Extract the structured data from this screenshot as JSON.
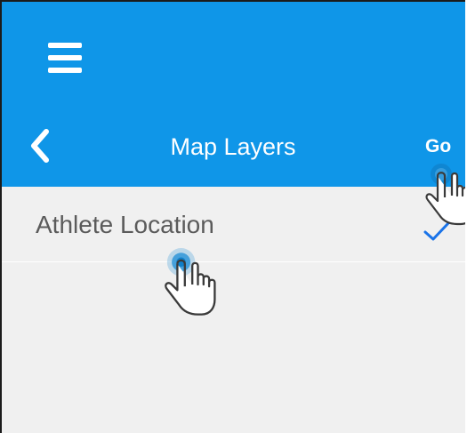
{
  "header": {
    "title": "Map Layers",
    "go_label": "Go",
    "menu_icon": "hamburger-menu-icon",
    "back_icon": "chevron-left-icon"
  },
  "layers": [
    {
      "label": "Athlete Location",
      "selected": true,
      "check_icon": "checkmark-icon"
    }
  ],
  "colors": {
    "appbar": "#0f96e8",
    "background": "#f0f0f0",
    "checkmark": "#1a73e8",
    "label_text": "#5b5b5b"
  },
  "tap_indicators": [
    {
      "target": "go-button",
      "icon": "hand-pointer-icon"
    },
    {
      "target": "layer-row-athlete-location",
      "icon": "hand-pointer-icon"
    }
  ]
}
